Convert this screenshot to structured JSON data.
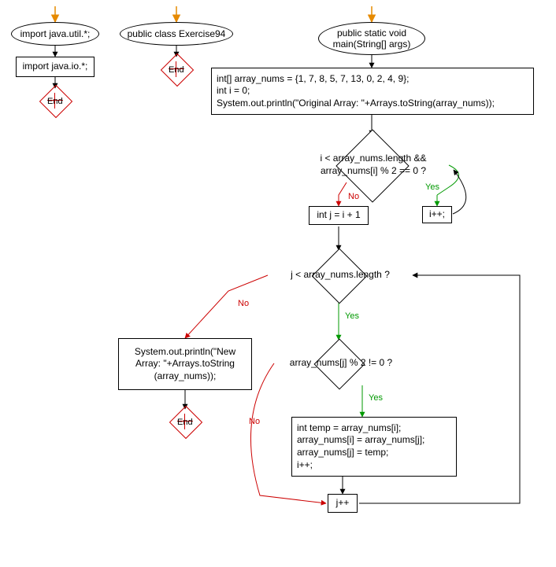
{
  "flow": {
    "import1": "import java.util.*;",
    "import2": "import java.io.*;",
    "class_decl": "public class Exercise94",
    "main_decl": "public static void\nmain(String[] args)",
    "init_block": "int[] array_nums = {1, 7, 8, 5, 7, 13, 0, 2, 4, 9};\nint i = 0;\nSystem.out.println(\"Original Array: \"+Arrays.toString(array_nums));",
    "cond1": "i < array_nums.length &&\narray_nums[i] % 2 == 0 ?",
    "inc_i": "i++;",
    "j_init": "int j = i + 1",
    "cond2": "j < array_nums.length ?",
    "print_new": "System.out.println(\"New\nArray: \"+Arrays.toString\n(array_nums));",
    "cond3": "array_nums[j] % 2 != 0 ?",
    "swap_block": "int temp = array_nums[i];\narray_nums[i] = array_nums[j];\narray_nums[j] = temp;\ni++;",
    "inc_j": "j++",
    "end": "End",
    "yes": "Yes",
    "no": "No"
  },
  "chart_data": {
    "type": "flowchart",
    "nodes": [
      {
        "id": "start1",
        "shape": "entry-arrow"
      },
      {
        "id": "n_import1",
        "shape": "ellipse",
        "text": "import java.util.*;"
      },
      {
        "id": "n_import2",
        "shape": "rect",
        "text": "import java.io.*;"
      },
      {
        "id": "end1",
        "shape": "end"
      },
      {
        "id": "start2",
        "shape": "entry-arrow"
      },
      {
        "id": "n_class",
        "shape": "ellipse",
        "text": "public class Exercise94"
      },
      {
        "id": "end2",
        "shape": "end"
      },
      {
        "id": "start3",
        "shape": "entry-arrow"
      },
      {
        "id": "n_main",
        "shape": "ellipse",
        "text": "public static void main(String[] args)"
      },
      {
        "id": "n_init",
        "shape": "rect",
        "text": "int[] array_nums = {1, 7, 8, 5, 7, 13, 0, 2, 4, 9}; int i = 0; System.out.println(\"Original Array: \"+Arrays.toString(array_nums));"
      },
      {
        "id": "n_cond1",
        "shape": "diamond",
        "text": "i < array_nums.length && array_nums[i] % 2 == 0 ?"
      },
      {
        "id": "n_inc_i",
        "shape": "rect",
        "text": "i++;"
      },
      {
        "id": "n_jinit",
        "shape": "rect",
        "text": "int j = i + 1"
      },
      {
        "id": "n_cond2",
        "shape": "diamond",
        "text": "j < array_nums.length ?"
      },
      {
        "id": "n_print",
        "shape": "rect",
        "text": "System.out.println(\"New Array: \"+Arrays.toString(array_nums));"
      },
      {
        "id": "end3",
        "shape": "end"
      },
      {
        "id": "n_cond3",
        "shape": "diamond",
        "text": "array_nums[j] % 2 != 0 ?"
      },
      {
        "id": "n_swap",
        "shape": "rect",
        "text": "int temp = array_nums[i]; array_nums[i] = array_nums[j]; array_nums[j] = temp; i++;"
      },
      {
        "id": "n_incj",
        "shape": "rect",
        "text": "j++"
      }
    ],
    "edges": [
      {
        "from": "start1",
        "to": "n_import1"
      },
      {
        "from": "n_import1",
        "to": "n_import2"
      },
      {
        "from": "n_import2",
        "to": "end1"
      },
      {
        "from": "start2",
        "to": "n_class"
      },
      {
        "from": "n_class",
        "to": "end2"
      },
      {
        "from": "start3",
        "to": "n_main"
      },
      {
        "from": "n_main",
        "to": "n_init"
      },
      {
        "from": "n_init",
        "to": "n_cond1"
      },
      {
        "from": "n_cond1",
        "to": "n_inc_i",
        "label": "Yes"
      },
      {
        "from": "n_inc_i",
        "to": "n_cond1"
      },
      {
        "from": "n_cond1",
        "to": "n_jinit",
        "label": "No"
      },
      {
        "from": "n_jinit",
        "to": "n_cond2"
      },
      {
        "from": "n_cond2",
        "to": "n_cond3",
        "label": "Yes"
      },
      {
        "from": "n_cond2",
        "to": "n_print",
        "label": "No"
      },
      {
        "from": "n_print",
        "to": "end3"
      },
      {
        "from": "n_cond3",
        "to": "n_swap",
        "label": "Yes"
      },
      {
        "from": "n_cond3",
        "to": "n_incj",
        "label": "No"
      },
      {
        "from": "n_swap",
        "to": "n_incj"
      },
      {
        "from": "n_incj",
        "to": "n_cond2"
      }
    ]
  }
}
